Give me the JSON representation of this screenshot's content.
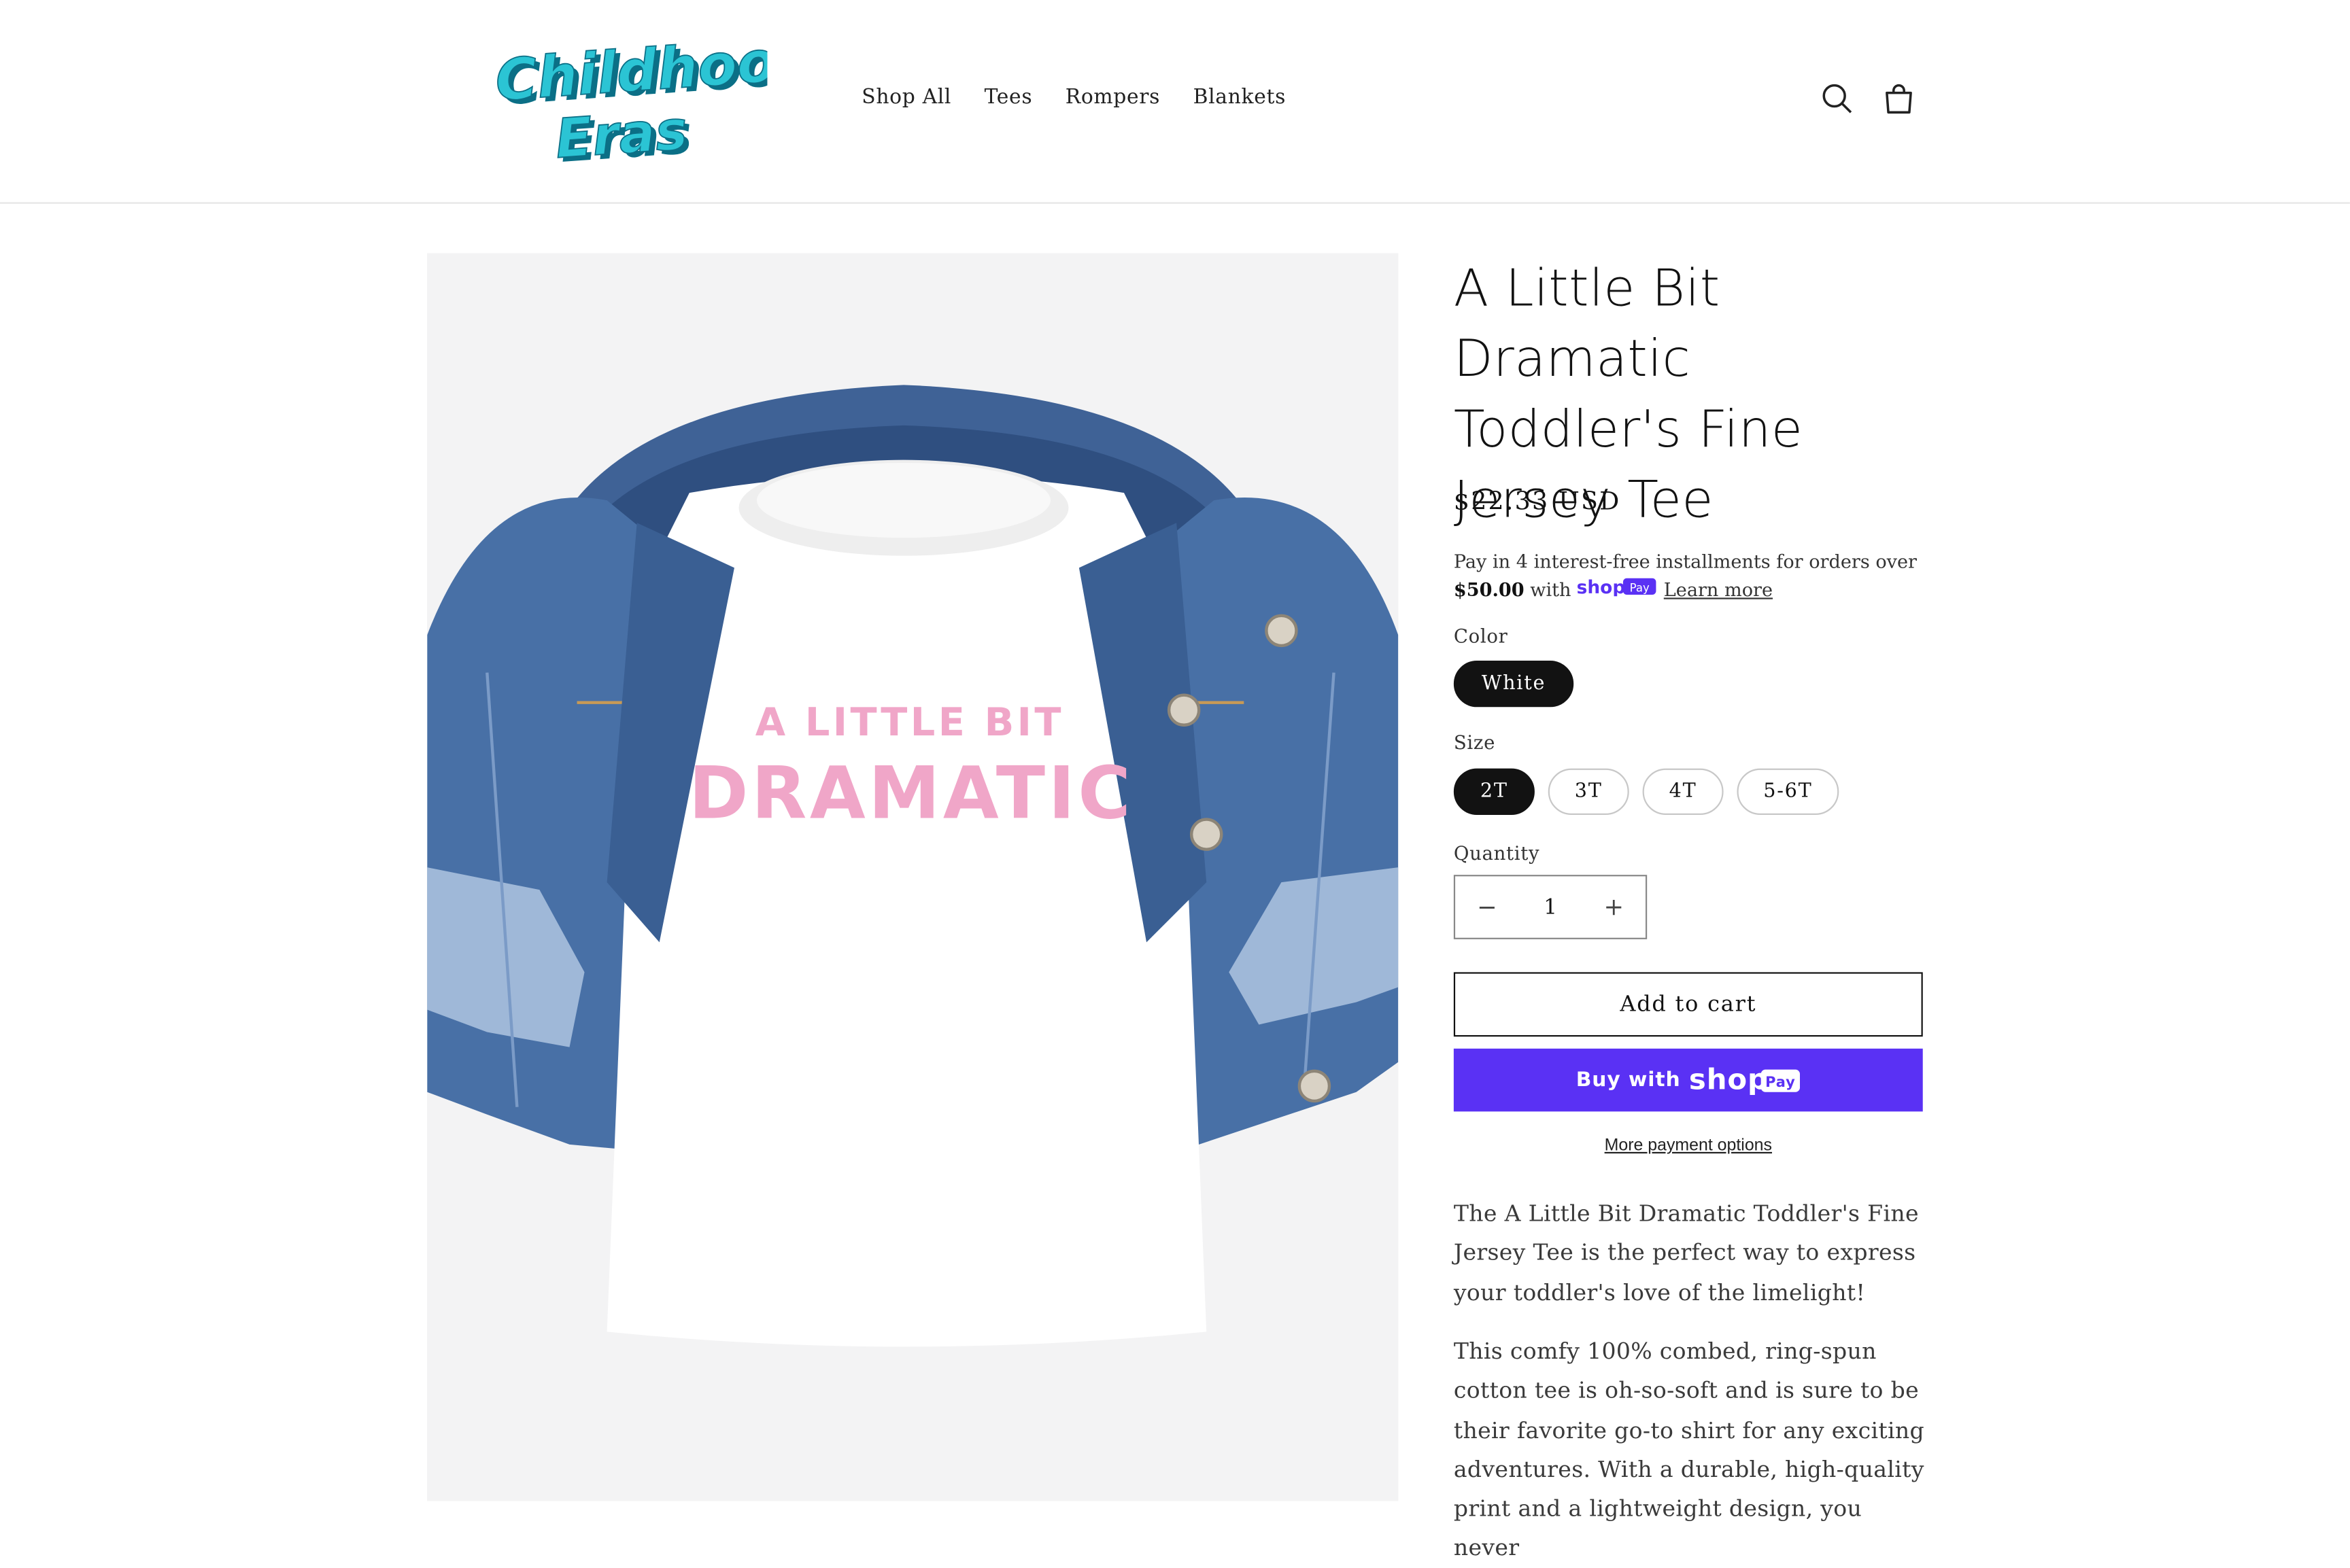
{
  "header": {
    "logo_line1": "Childhood",
    "logo_line2": "Eras",
    "nav": [
      "Shop All",
      "Tees",
      "Rompers",
      "Blankets"
    ]
  },
  "product": {
    "image_text_line1": "A LITTLE BIT",
    "image_text_line2": "DRAMATIC",
    "title": "A Little Bit Dramatic Toddler's Fine Jersey Tee",
    "price": "$22.33 USD",
    "installments_text": "Pay in 4 interest-free installments for orders over",
    "installments_amount": "$50.00",
    "installments_with": "with",
    "shop_brand": "shop",
    "pay_badge": "Pay",
    "learn_more": "Learn more",
    "color_label": "Color",
    "colors": [
      "White"
    ],
    "size_label": "Size",
    "sizes": [
      "2T",
      "3T",
      "4T",
      "5-6T"
    ],
    "quantity_label": "Quantity",
    "quantity_minus": "−",
    "quantity_value": "1",
    "quantity_plus": "+",
    "add_to_cart": "Add to cart",
    "buy_with": "Buy with",
    "more_payment_options": "More payment options",
    "description": [
      "The A Little Bit Dramatic Toddler's Fine Jersey Tee is the perfect way to express your toddler's love of the limelight!",
      "This comfy 100% combed, ring-spun cotton tee is oh-so-soft and is sure to be their favorite go-to shirt for any exciting adventures. With a durable, high-quality print and a lightweight design, you never"
    ]
  },
  "colors": {
    "logo_teal": "#2bc4d4",
    "logo_dark": "#0b6f86",
    "shop_pay_purple": "#5a31f4",
    "tee_print_pink": "#f0a6c8",
    "denim": "#3a5f93"
  }
}
